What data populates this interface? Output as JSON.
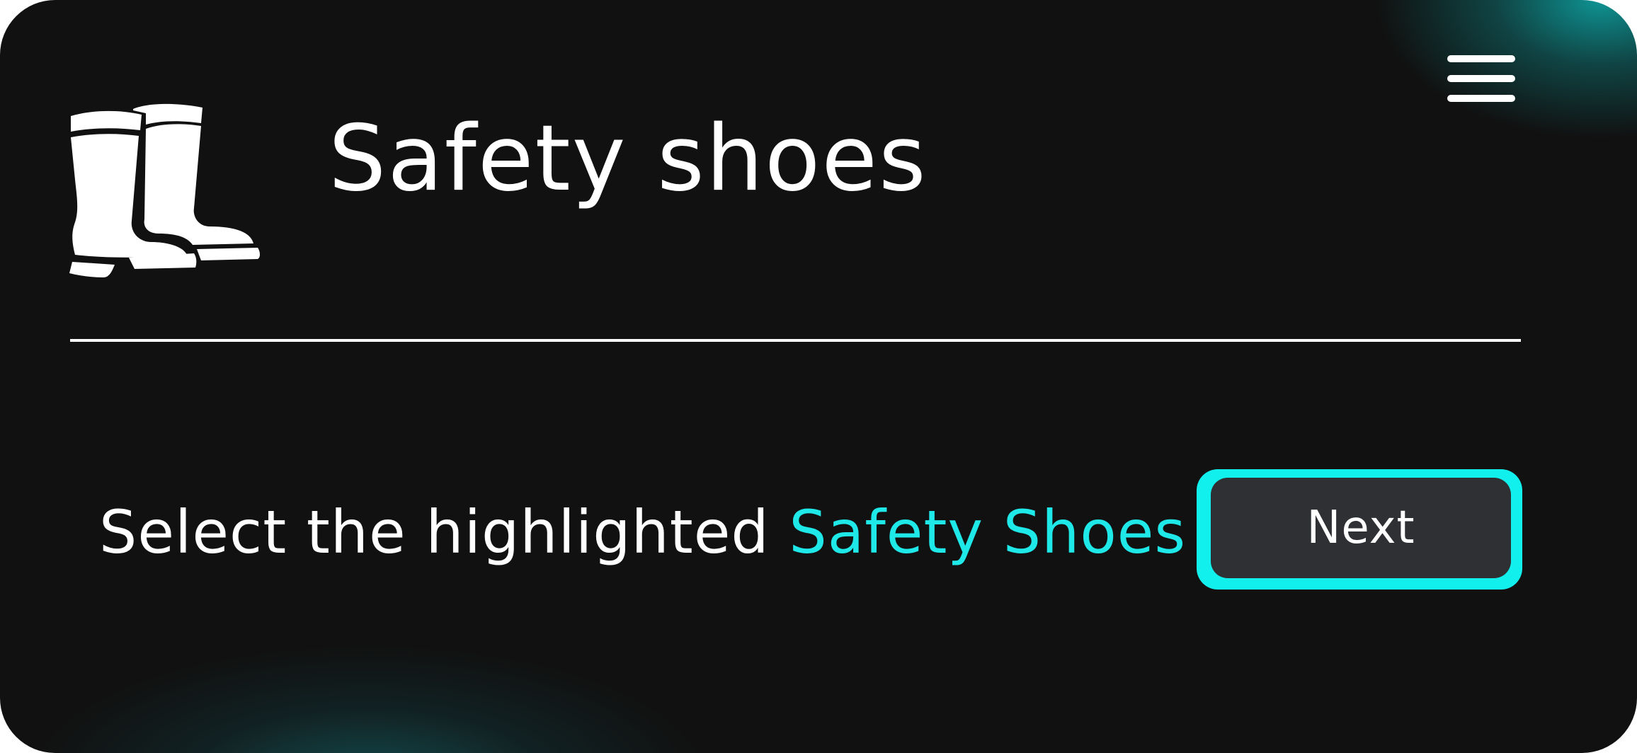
{
  "header": {
    "icon": "rubber-boots-icon",
    "title": "Safety shoes",
    "menu_icon": "hamburger-menu-icon"
  },
  "instruction": {
    "prefix": "Select the highlighted ",
    "highlight": "Safety Shoes"
  },
  "actions": {
    "next_label": "Next"
  },
  "colors": {
    "background": "#111111",
    "accent": "#12F0EE",
    "button_fill": "#2E3033",
    "text": "#FFFFFF"
  }
}
